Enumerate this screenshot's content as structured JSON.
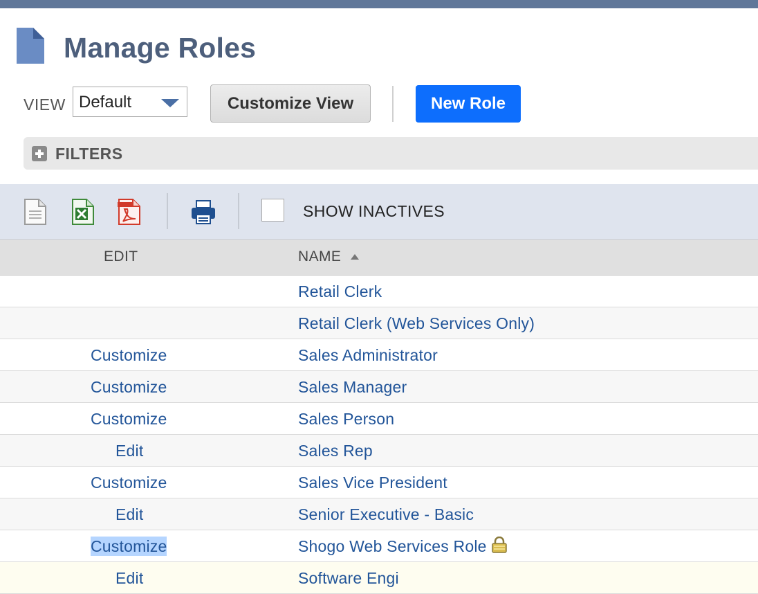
{
  "page": {
    "title": "Manage Roles",
    "icon": "document-icon"
  },
  "toolbar": {
    "view_label": "VIEW",
    "view_value": "Default",
    "customize_view_label": "Customize View",
    "new_role_label": "New Role",
    "accent_color": "#0d6efd"
  },
  "filters": {
    "label": "FILTERS"
  },
  "export_bar": {
    "icons": [
      "csv-export-icon",
      "excel-export-icon",
      "pdf-export-icon",
      "print-icon"
    ],
    "show_inactives_label": "SHOW INACTIVES",
    "show_inactives_checked": false
  },
  "table": {
    "columns": [
      "EDIT",
      "NAME"
    ],
    "sort_column": "NAME",
    "sort_direction": "ascending",
    "rows": [
      {
        "edit": "",
        "name": "Retail Clerk"
      },
      {
        "edit": "",
        "name": "Retail Clerk (Web Services Only)"
      },
      {
        "edit": "Customize",
        "name": "Sales Administrator"
      },
      {
        "edit": "Customize",
        "name": "Sales Manager"
      },
      {
        "edit": "Customize",
        "name": "Sales Person"
      },
      {
        "edit": "Edit",
        "name": "Sales Rep"
      },
      {
        "edit": "Customize",
        "name": "Sales Vice President"
      },
      {
        "edit": "Edit",
        "name": "Senior Executive - Basic"
      },
      {
        "edit": "Customize",
        "name": "Shogo Web Services Role",
        "locked": true,
        "edit_selected": true
      },
      {
        "edit": "Edit",
        "name": "Software Engi"
      }
    ]
  }
}
